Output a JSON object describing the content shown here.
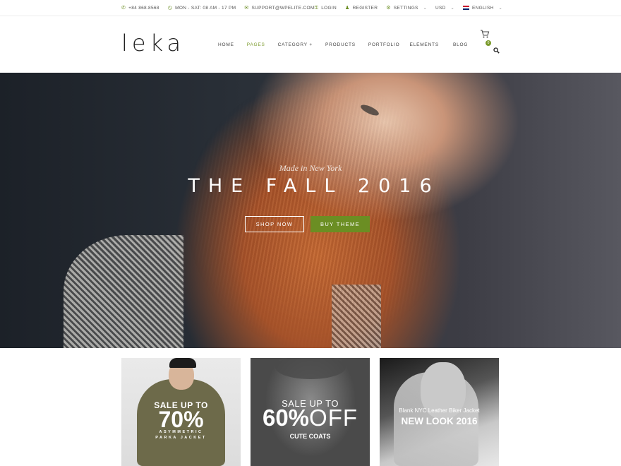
{
  "topbar": {
    "phone": "+84 868.8568",
    "hours": "MON - SAT: 08 AM - 17 PM",
    "email": "SUPPORT@WPELITE.COM",
    "login": "LOGIN",
    "register": "REGISTER",
    "settings": "SETTINGS",
    "currency": "USD",
    "language": "ENGLISH"
  },
  "header": {
    "logo": "leka",
    "menu": [
      "HOME",
      "PAGES",
      "CATEGORY +",
      "PRODUCTS",
      "PORTFOLIO",
      "ELEMENTS",
      "BLOG"
    ],
    "active_item": "PAGES",
    "cart_count": "0"
  },
  "hero": {
    "subtitle": "Made in New York",
    "title": "THE FALL 2016",
    "shop_button": "SHOP NOW",
    "buy_button": "BUY THEME"
  },
  "promos": [
    {
      "line1": "SALE UP TO",
      "line2": "70%",
      "line3a": "ASYMMETRIC",
      "line3b": "PARKA JACKET"
    },
    {
      "line1": "SALE UP TO",
      "line2a": "60%",
      "line2b": "OFF",
      "line3": "CUTE COATS"
    },
    {
      "line1": "Blank NYC Leather Biker Jacket",
      "line2": "NEW LOOK 2016"
    }
  ],
  "colors": {
    "accent": "#6b8e23"
  }
}
